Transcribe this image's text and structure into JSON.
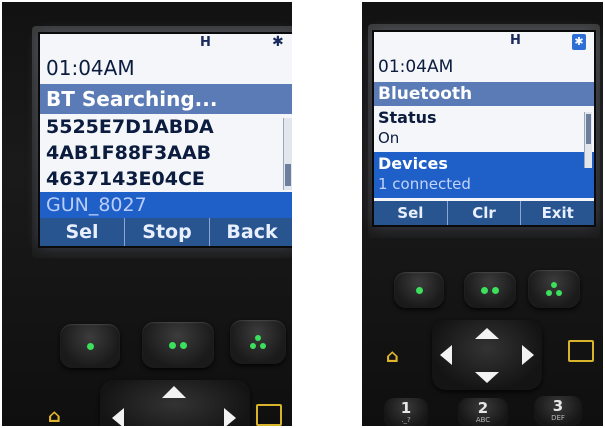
{
  "left_phone": {
    "signal": "H",
    "bt_glyph": "✱",
    "clock": "01:04AM",
    "title": "BT Searching...",
    "devices": [
      "5525E7D1ABDA",
      "4AB1F88F3AAB",
      "4637143E04CE",
      "GUN_8027"
    ],
    "softkeys": [
      "Sel",
      "Stop",
      "Back"
    ]
  },
  "right_phone": {
    "signal": "H",
    "bt_glyph": "✱",
    "clock": "01:04AM",
    "title": "Bluetooth",
    "items": [
      {
        "label": "Status",
        "value": "On"
      },
      {
        "label": "Devices",
        "value": "1 connected"
      }
    ],
    "softkeys": [
      "Sel",
      "Clr",
      "Exit"
    ],
    "numkeys": [
      {
        "digit": "1",
        "letters": "._?"
      },
      {
        "digit": "2",
        "letters": "ABC"
      },
      {
        "digit": "3",
        "letters": "DEF"
      }
    ]
  },
  "colors": {
    "title_bar": "#5a7bb5",
    "selection": "#1f5fc8",
    "softkey_bar": "#28558f",
    "key_led": "#3be05c",
    "side_icon": "#d7b42a"
  },
  "icons": {
    "signal": "signal-h-icon",
    "bluetooth": "bluetooth-icon",
    "home": "home-icon",
    "phonebook": "phonebook-icon",
    "nav": "navigation-pad"
  }
}
